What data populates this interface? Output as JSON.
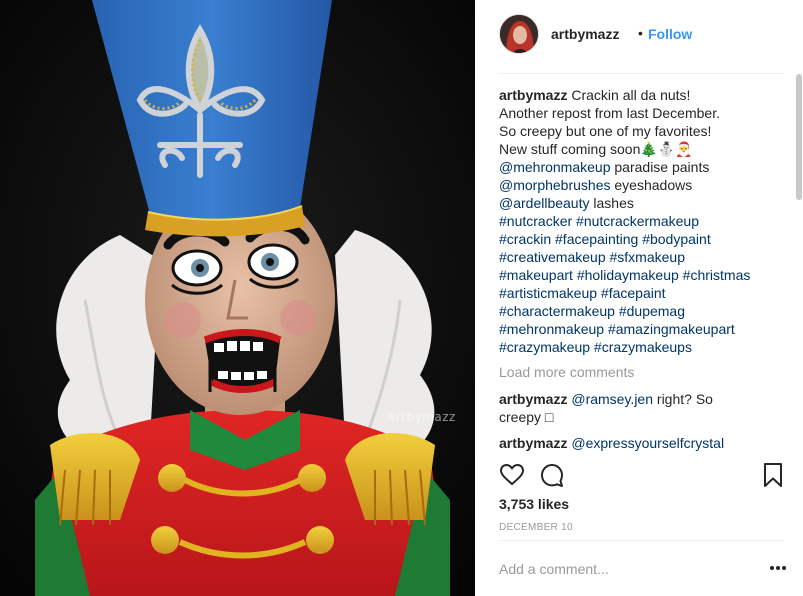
{
  "photo": {
    "watermark": "artbymazz"
  },
  "header": {
    "username": "artbymazz",
    "separator": "•",
    "follow_label": "Follow"
  },
  "caption": {
    "username": "artbymazz",
    "text_lines": [
      "Crackin all da nuts!",
      "Another repost from last December.",
      "So creepy but one of my favorites!",
      "New stuff coming soon🎄⛄🎅"
    ],
    "credit_lines": [
      {
        "mention": "@mehronmakeup",
        "text": " paradise paints"
      },
      {
        "mention": "@morphebrushes",
        "text": " eyeshadows"
      },
      {
        "mention": "@ardellbeauty",
        "text": " lashes"
      }
    ],
    "hashtag_lines": [
      "#nutcracker #nutcrackermakeup",
      "#crackin #facepainting #bodypaint",
      "#creativemakeup #sfxmakeup",
      "#makeupart #holidaymakeup #christmas",
      "#artisticmakeup #facepaint",
      "#charactermakeup #dupemag",
      "#mehronmakeup #amazingmakeupart",
      "#crazymakeup #crazymakeups"
    ]
  },
  "load_more": "Load more comments",
  "comments": [
    {
      "username": "artbymazz",
      "mention": "@ramsey.jen",
      "text": " right? So",
      "text_line2": "creepy □"
    },
    {
      "username": "artbymazz",
      "mention": "@expressyourselfcrystal",
      "text": ""
    }
  ],
  "actions": {
    "like_icon": "heart-icon",
    "comment_icon": "speech-bubble-icon",
    "save_icon": "bookmark-icon"
  },
  "likes": "3,753 likes",
  "date": "DECEMBER 10",
  "add_comment": {
    "placeholder": "Add a comment..."
  },
  "colors": {
    "link": "#003569",
    "follow": "#3897f0",
    "muted": "#999999",
    "hat_blue": "#2f6fc1",
    "coat_red": "#d6201e",
    "gold": "#e2b321"
  }
}
